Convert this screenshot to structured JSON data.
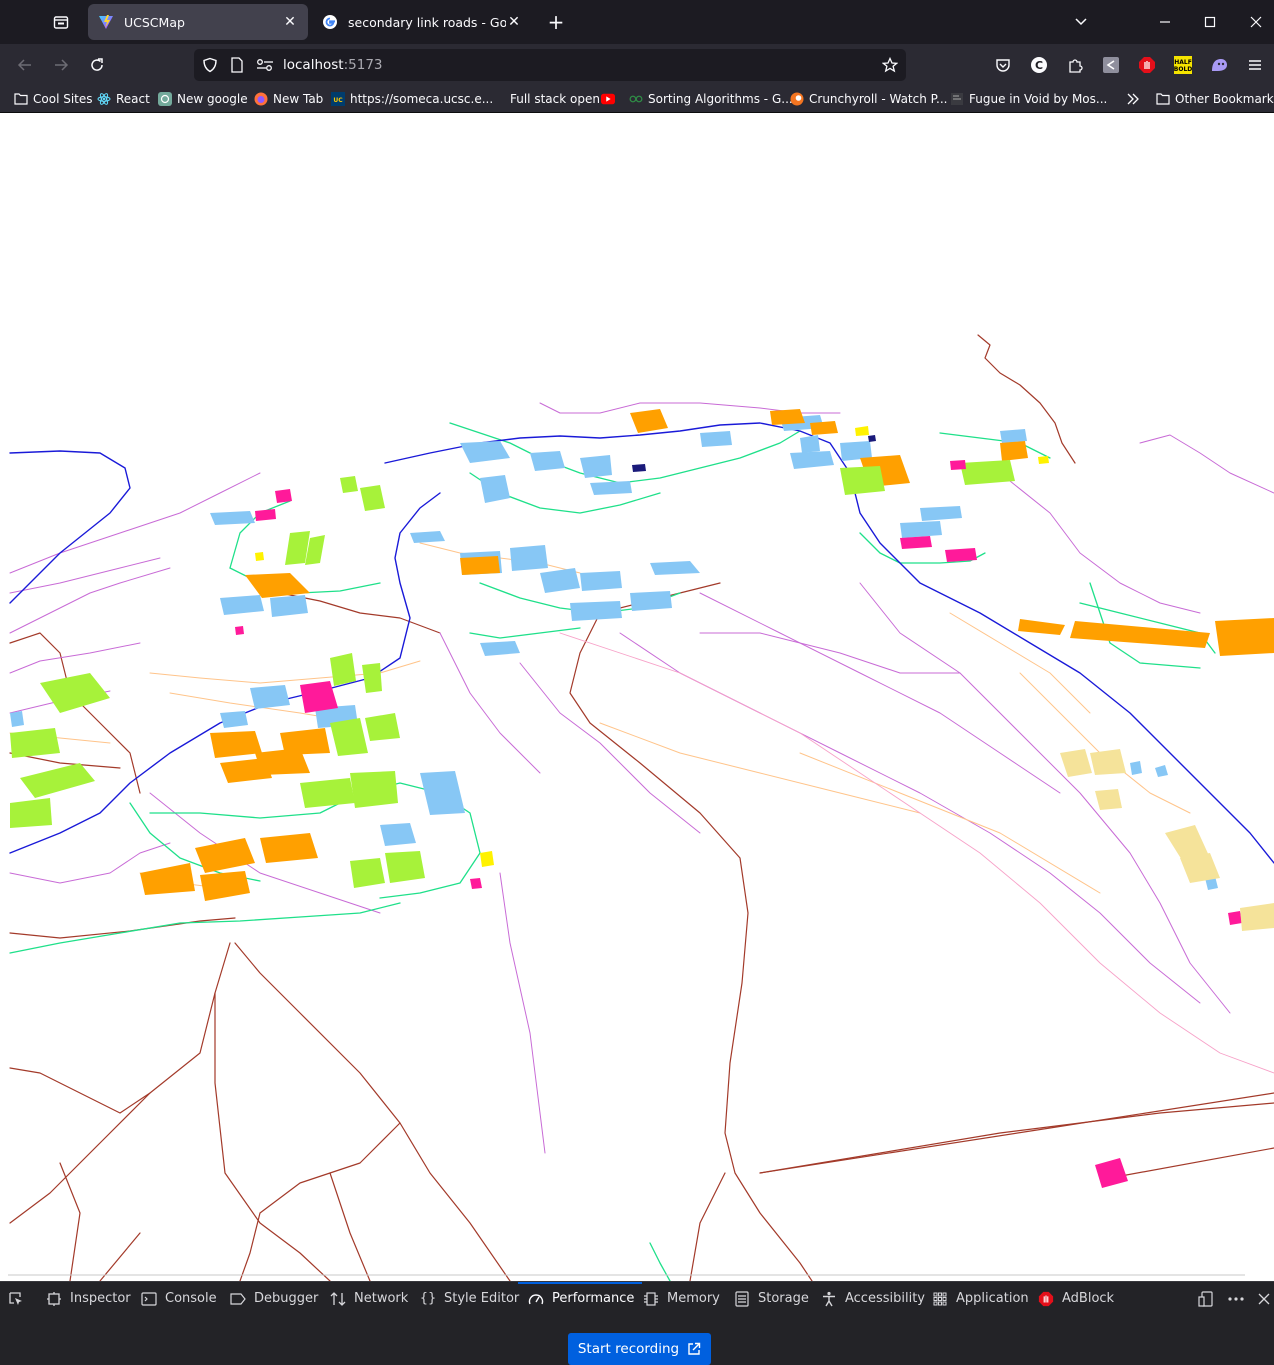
{
  "tabs": [
    {
      "title": "UCSCMap",
      "active": true
    },
    {
      "title": "secondary link roads - Google Se",
      "active": false
    }
  ],
  "url": {
    "host": "localhost",
    "port": ":5173"
  },
  "bookmarks": [
    {
      "label": "Cool Sites",
      "icon": "folder-icon"
    },
    {
      "label": "React",
      "icon": "react-icon"
    },
    {
      "label": "New google",
      "icon": "chatgpt-icon"
    },
    {
      "label": "New Tab",
      "icon": "firefox-icon"
    },
    {
      "label": "https://someca.ucsc.e...",
      "icon": "ucsc-icon"
    },
    {
      "label": "Full stack open",
      "icon": "blank-icon"
    },
    {
      "label": "",
      "icon": "youtube-icon"
    },
    {
      "label": "Sorting Algorithms - G...",
      "icon": "gfg-icon"
    },
    {
      "label": "Crunchyroll - Watch P...",
      "icon": "crunchyroll-icon"
    },
    {
      "label": "Fugue in Void by Mos...",
      "icon": "page-icon"
    }
  ],
  "other_bookmarks": "Other Bookmarks",
  "devtools": {
    "tabs": [
      "Inspector",
      "Console",
      "Debugger",
      "Network",
      "Style Editor",
      "Performance",
      "Memory",
      "Storage",
      "Accessibility",
      "Application",
      "AdBlock"
    ],
    "selected": "Performance",
    "record_button": "Start recording"
  },
  "map_colors": {
    "building_blue": "#87c7f5",
    "building_orange": "#ffa000",
    "building_green": "#a7f23a",
    "building_magenta": "#ff1a9a",
    "building_yellow": "#f5e39a",
    "road_brown": "#a33a2a",
    "path_purple": "#c86bd6",
    "footway_green": "#1fe08a",
    "primary_blue": "#1a1ad8",
    "service_orange": "#ffc48a"
  }
}
